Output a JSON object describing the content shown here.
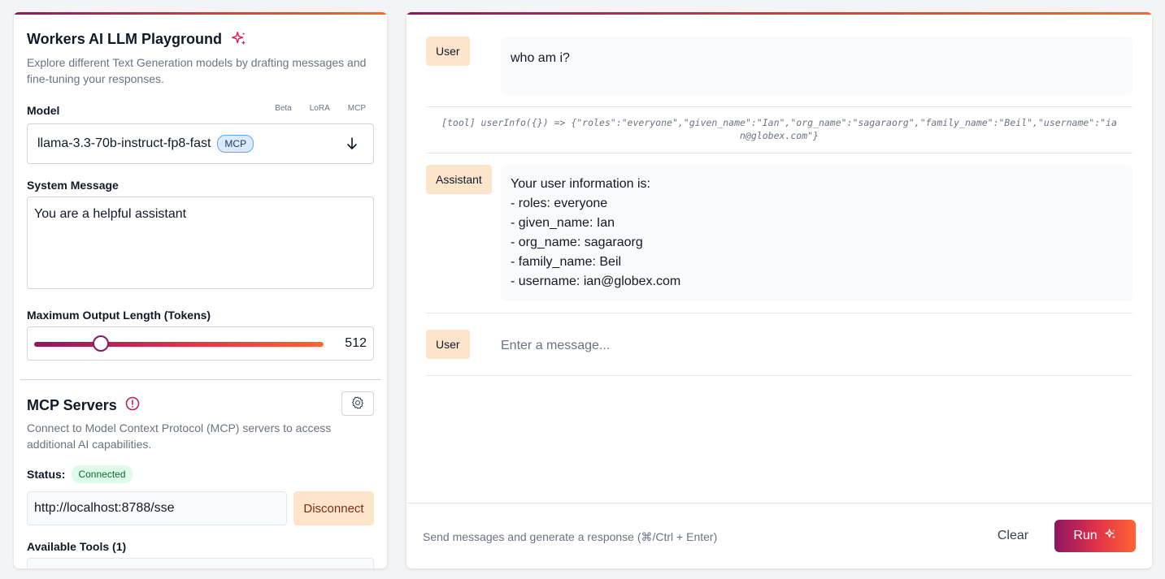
{
  "sidebar": {
    "title": "Workers AI LLM Playground",
    "description": "Explore different Text Generation models by drafting messages and fine-tuning your responses.",
    "model_label": "Model",
    "model_tags": [
      "Beta",
      "LoRA",
      "MCP"
    ],
    "model_selected": "llama-3.3-70b-instruct-fp8-fast",
    "model_badge": "MCP",
    "system_label": "System Message",
    "system_value": "You are a helpful assistant",
    "max_tokens_label": "Maximum Output Length (Tokens)",
    "max_tokens_value": "512",
    "max_tokens_fraction": 0.23,
    "mcp": {
      "title": "MCP Servers",
      "description": "Connect to Model Context Protocol (MCP) servers to access additional AI capabilities.",
      "status_label": "Status:",
      "status_value": "Connected",
      "url_value": "http://localhost:8788/sse",
      "disconnect_label": "Disconnect",
      "tools_label": "Available Tools (1)"
    }
  },
  "chat": {
    "messages": [
      {
        "role": "User",
        "lines": [
          "who am i?"
        ]
      },
      {
        "role": "Assistant",
        "lines": [
          "Your user information is:",
          "- roles: everyone",
          "- given_name: Ian",
          "- org_name: sagaraorg",
          "- family_name: Beil",
          "- username: ian@globex.com"
        ]
      }
    ],
    "tool_call": "[tool] userInfo({}) => {\"roles\":\"everyone\",\"given_name\":\"Ian\",\"org_name\":\"sagaraorg\",\"family_name\":\"Beil\",\"username\":\"ian@globex.com\"}",
    "input_role": "User",
    "input_placeholder": "Enter a message...",
    "hint": "Send messages and generate a response (⌘/Ctrl + Enter)",
    "clear_label": "Clear",
    "run_label": "Run"
  },
  "icons": {
    "title": "sparkle-icon",
    "model_select": "arrow-down-icon",
    "mcp_status": "alert-circle-icon",
    "mcp_settings": "gear-icon",
    "run": "sparkle-icon"
  },
  "colors": {
    "accent_start": "#8e1661",
    "accent_mid": "#e0304a",
    "accent_end": "#ff6433",
    "role_chip": "#fde5cc",
    "connected": "#dcfce7"
  }
}
